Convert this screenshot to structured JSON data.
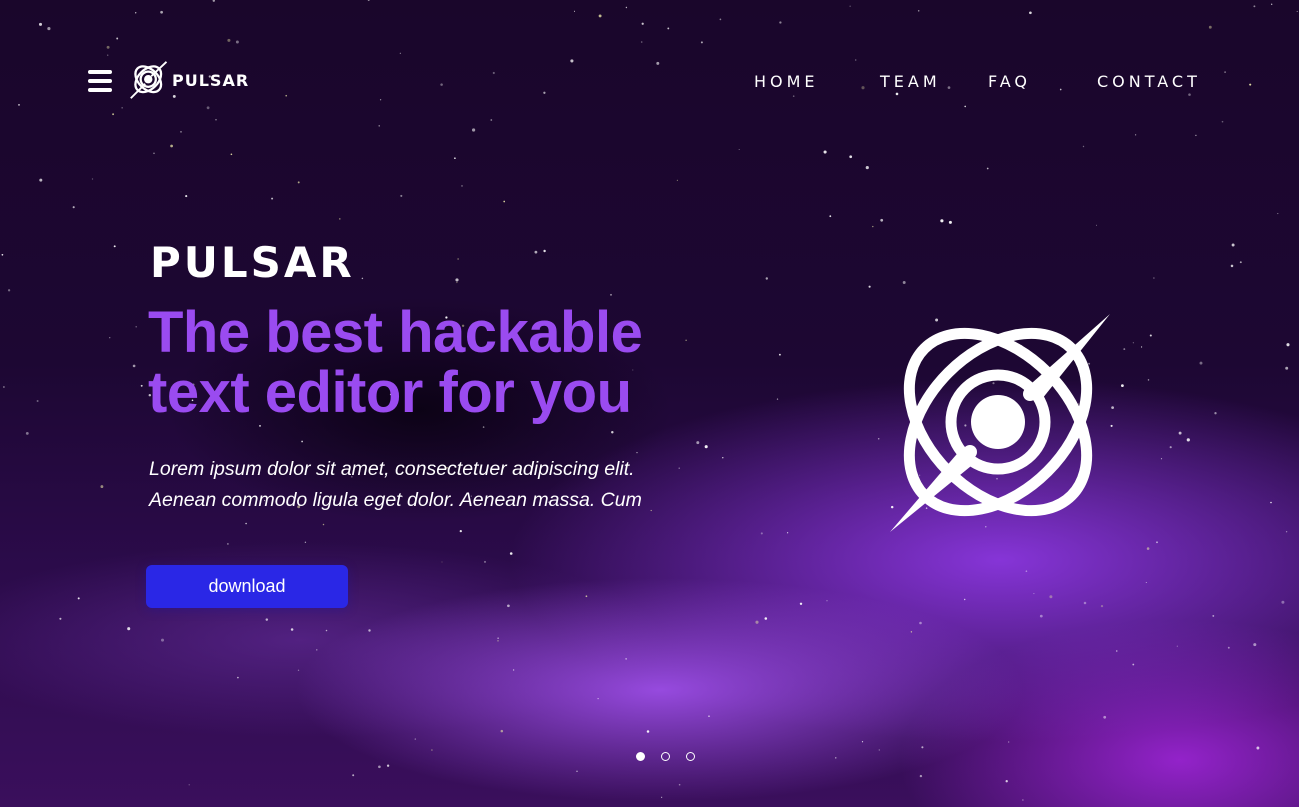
{
  "brand": {
    "name": "PULSAR",
    "logo_icon": "pulsar-logo-icon"
  },
  "header": {
    "menu_icon": "hamburger-menu-icon",
    "nav": [
      {
        "label": "HOME"
      },
      {
        "label": "TEAM"
      },
      {
        "label": "FAQ"
      },
      {
        "label": "CONTACT"
      }
    ]
  },
  "hero": {
    "brand": "PULSAR",
    "title_line1": "The best hackable",
    "title_line2": "text editor for you",
    "desc_line1": "Lorem ipsum dolor sit amet, consectetuer adipiscing elit.",
    "desc_line2": "Aenean commodo ligula eget dolor. Aenean massa. Cum",
    "download_label": "download"
  },
  "carousel": {
    "slides": 3,
    "active_index": 0
  },
  "colors": {
    "accent": "#9a4bf0",
    "button": "#2a27e6",
    "background": "#1a062b"
  }
}
